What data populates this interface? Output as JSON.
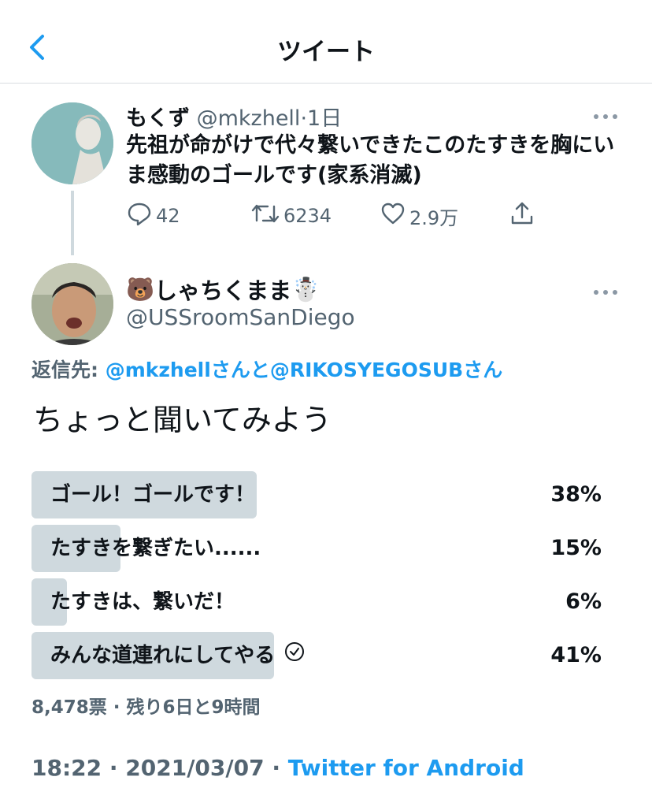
{
  "header": {
    "title": "ツイート"
  },
  "tweet1": {
    "name": "もくず",
    "handle": "@mkzhell",
    "separator": "·",
    "time": "1日",
    "text": "先祖が命がけで代々繋いできたこのたすきを胸にいま感動のゴールです(家系消滅)",
    "reply_count": "42",
    "retweet_count": "6234",
    "like_count": "2.9万"
  },
  "tweet2": {
    "name": "しゃちくまま",
    "emoji_left": "🐻",
    "emoji_right": "☃️",
    "handle": "@USSroomSanDiego",
    "reply_prefix": "返信先: ",
    "reply_to": "@mkzhellさんと@RIKOSYEGOSUBさん",
    "text": "ちょっと聞いてみよう",
    "poll": {
      "options": [
        {
          "label": "ゴール！ゴールです！",
          "percent": "38%",
          "fraction": 0.38,
          "selected": false
        },
        {
          "label": "たすきを繋ぎたい......",
          "percent": "15%",
          "fraction": 0.15,
          "selected": false
        },
        {
          "label": "たすきは、繋いだ！",
          "percent": "6%",
          "fraction": 0.06,
          "selected": false
        },
        {
          "label": "みんな道連れにしてやる",
          "percent": "41%",
          "fraction": 0.41,
          "selected": true
        }
      ],
      "meta": "8,478票 · 残り6日と9時間"
    },
    "timestamp": "18:22 · 2021/03/07 · ",
    "source": "Twitter for Android"
  },
  "colors": {
    "link": "#1d9bf0",
    "muted": "#536471",
    "poll_bar": "#cfd9de"
  }
}
